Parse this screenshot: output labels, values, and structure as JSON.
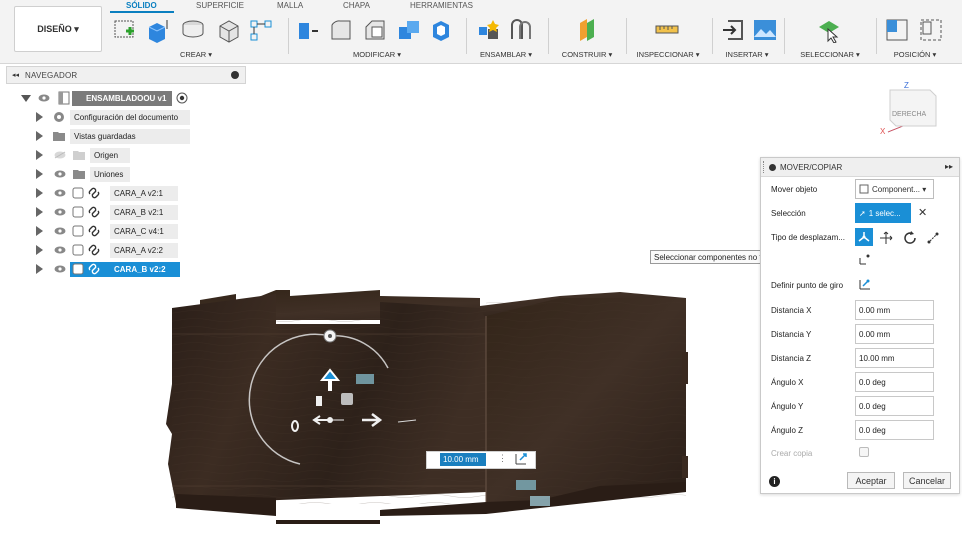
{
  "workspace": {
    "label": "DISEÑO ▾"
  },
  "tabs": [
    "SÓLIDO",
    "SUPERFICIE",
    "MALLA",
    "CHAPA",
    "HERRAMIENTAS"
  ],
  "groups": {
    "crear": "CREAR ▾",
    "modificar": "MODIFICAR ▾",
    "ensamblar": "ENSAMBLAR ▾",
    "construir": "CONSTRUIR ▾",
    "inspeccionar": "INSPECCIONAR ▾",
    "insertar": "INSERTAR ▾",
    "seleccionar": "SELECCIONAR ▾",
    "posicion": "POSICIÓN ▾"
  },
  "navigator": {
    "title": "NAVEGADOR",
    "root": "ENSAMBLADOOU v1",
    "items": [
      {
        "label": "Configuración del documento",
        "icon": "gear-icon"
      },
      {
        "label": "Vistas guardadas",
        "icon": "folder-icon"
      },
      {
        "label": "Origen",
        "icon": "folder-icon"
      },
      {
        "label": "Uniones",
        "icon": "folder-icon"
      },
      {
        "label": "CARA_A v2:1",
        "icon": "component-link-icon"
      },
      {
        "label": "CARA_B v2:1",
        "icon": "component-link-icon"
      },
      {
        "label": "CARA_C v4:1",
        "icon": "component-link-icon"
      },
      {
        "label": "CARA_A v2:2",
        "icon": "component-link-icon"
      },
      {
        "label": "CARA_B v2:2",
        "icon": "component-link-icon"
      }
    ]
  },
  "viewcube": {
    "face": "DERECHA",
    "axis_z": "Z",
    "axis_x": "X"
  },
  "dialog": {
    "title": "MOVER/COPIAR",
    "move_object_label": "Mover objeto",
    "move_object_value": "Component... ▾",
    "selection_label": "Selección",
    "selection_value": "1 selec...",
    "move_type_label": "Tipo de desplazam...",
    "tooltip": "Seleccionar componentes no fijos para desplazarlos",
    "pivot_label": "Definir punto de giro",
    "fields": [
      {
        "label": "Distancia X",
        "value": "0.00 mm"
      },
      {
        "label": "Distancia Y",
        "value": "0.00 mm"
      },
      {
        "label": "Distancia Z",
        "value": "10.00 mm"
      },
      {
        "label": "Ángulo X",
        "value": "0.0 deg"
      },
      {
        "label": "Ángulo Y",
        "value": "0.0 deg"
      },
      {
        "label": "Ángulo Z",
        "value": "0.0 deg"
      }
    ],
    "create_copy_label": "Crear copia",
    "ok": "Aceptar",
    "cancel": "Cancelar"
  },
  "canvas": {
    "distance_input": "10.00 mm"
  },
  "colors": {
    "accent": "#1a8fd6",
    "wood": "#3a2b22"
  }
}
